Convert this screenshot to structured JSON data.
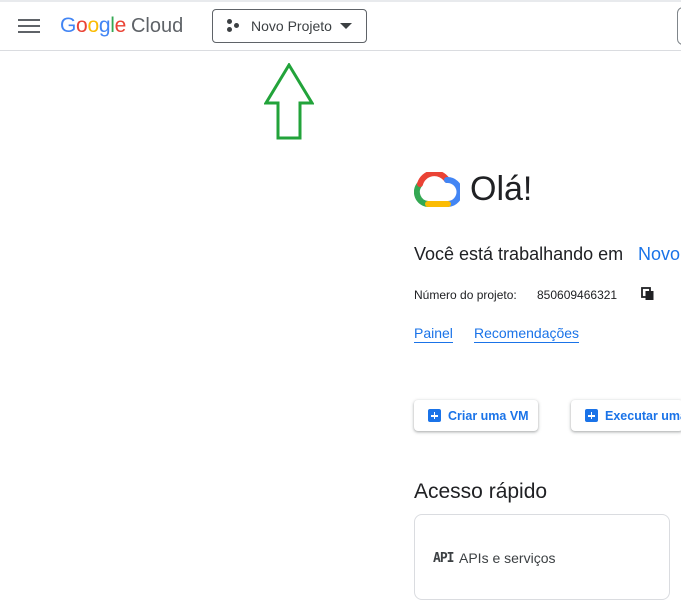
{
  "header": {
    "logo_google": "Google",
    "logo_cloud": "Cloud",
    "project_name": "Novo Projeto"
  },
  "main": {
    "greeting": "Olá!",
    "working_prefix": "Você está trabalhando em",
    "working_project": "Novo",
    "project_number_label": "Número do projeto:",
    "project_number": "850609466321",
    "links": [
      "Painel",
      "Recomendações"
    ],
    "actions": [
      "Criar uma VM",
      "Executar uma"
    ],
    "quick_access_title": "Acesso rápido",
    "quick_access_items": [
      {
        "icon_text": "API",
        "label": "APIs e serviços"
      }
    ]
  },
  "colors": {
    "accent": "#1a73e8",
    "annotation_arrow": "#22a33a"
  },
  "icons": [
    "menu-icon",
    "project-dots-icon",
    "caret-down-icon",
    "google-cloud-logo-icon",
    "copy-icon",
    "plus-icon",
    "api-icon",
    "up-arrow-annotation"
  ]
}
